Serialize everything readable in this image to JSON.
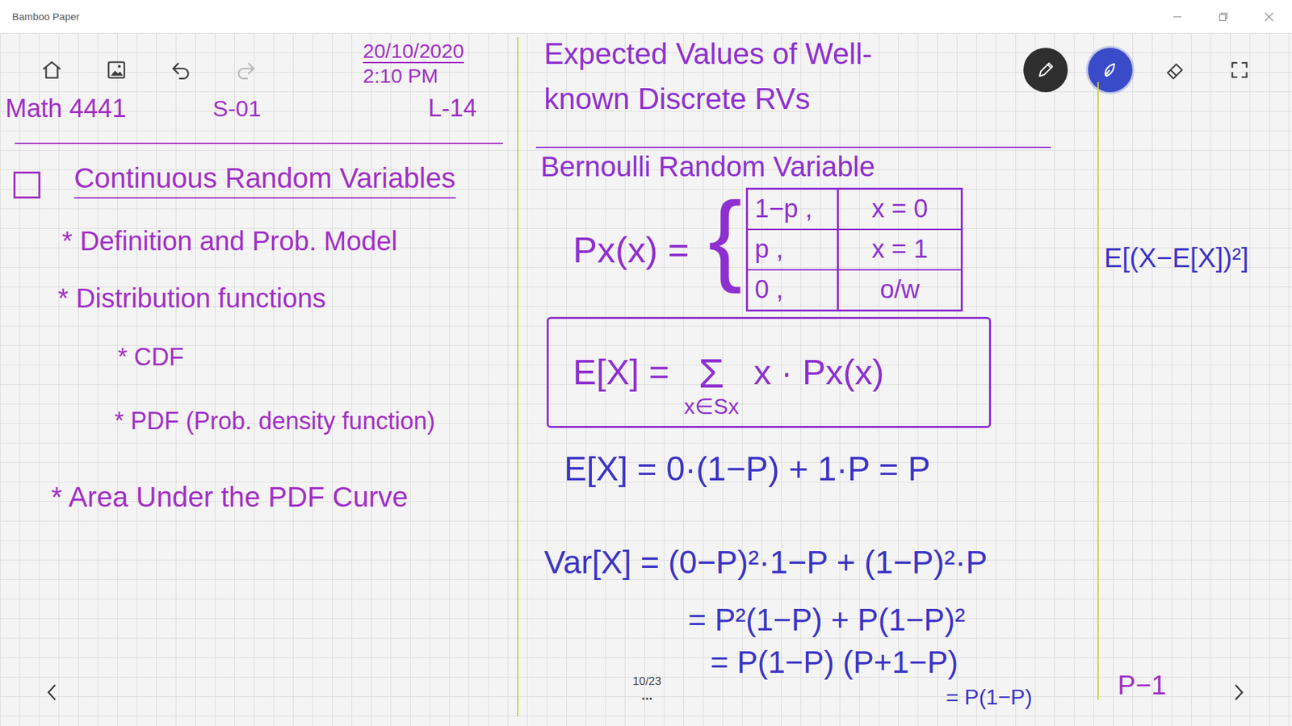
{
  "window": {
    "title": "Bamboo Paper"
  },
  "toolbar": {
    "actions": [
      {
        "kind": "home",
        "disabled": false
      },
      {
        "kind": "image",
        "disabled": false
      },
      {
        "kind": "undo",
        "disabled": false
      },
      {
        "kind": "redo",
        "disabled": true
      }
    ],
    "tools": [
      {
        "kind": "pencil",
        "selected": false,
        "color": "#2f2f2f"
      },
      {
        "kind": "pen",
        "selected": true,
        "color": "#3a4bc9"
      },
      {
        "kind": "eraser",
        "selected": false
      },
      {
        "kind": "select",
        "selected": false
      }
    ]
  },
  "page": {
    "indicator": "10/23",
    "more": "..."
  },
  "note": {
    "header": {
      "date": "20/10/2020",
      "time": "2:10 PM",
      "course": "Math 4441",
      "section": "S-01",
      "lecture": "L-14"
    },
    "outline": {
      "checked": false,
      "title": "Continuous Random Variables",
      "items": [
        {
          "text": "* Definition and Prob. Model",
          "kind": "bullet"
        },
        {
          "text": "* Distribution functions",
          "kind": "bullet"
        },
        {
          "text": "* CDF",
          "kind": "sub-bullet"
        },
        {
          "text": "* PDF (Prob. density function)",
          "kind": "sub-bullet"
        },
        {
          "text": "* Area Under the PDF Curve",
          "kind": "bullet"
        }
      ]
    },
    "heading": [
      "Expected Values of Well-",
      "known Discrete RVs"
    ],
    "subheading": "Bernoulli Random Variable",
    "pmf": {
      "label": "Px(x) =",
      "brace": "{",
      "rows": [
        {
          "value": "1−p ,",
          "condition": "x = 0"
        },
        {
          "value": "p ,",
          "condition": "x = 1"
        },
        {
          "value": "0 ,",
          "condition": "o/w"
        }
      ]
    },
    "expectation": {
      "lhs": "E[X] =",
      "sigma": "Σ",
      "index": "x∈Sx",
      "term": "x · Px(x)"
    },
    "derivation": [
      "E[X] = 0·(1−P) + 1·P = P",
      "Var[X] = (0−P)²·1−P + (1−P)²·P",
      "= P²(1−P) + P(1−P)²",
      "= P(1−P) (P+1−P)",
      "= P(1−P)"
    ],
    "aside": [
      {
        "text": "E[(X−E[X])²]",
        "color": "#3b33c6"
      },
      {
        "text": "P−1",
        "color": "#a12fc6"
      }
    ]
  }
}
